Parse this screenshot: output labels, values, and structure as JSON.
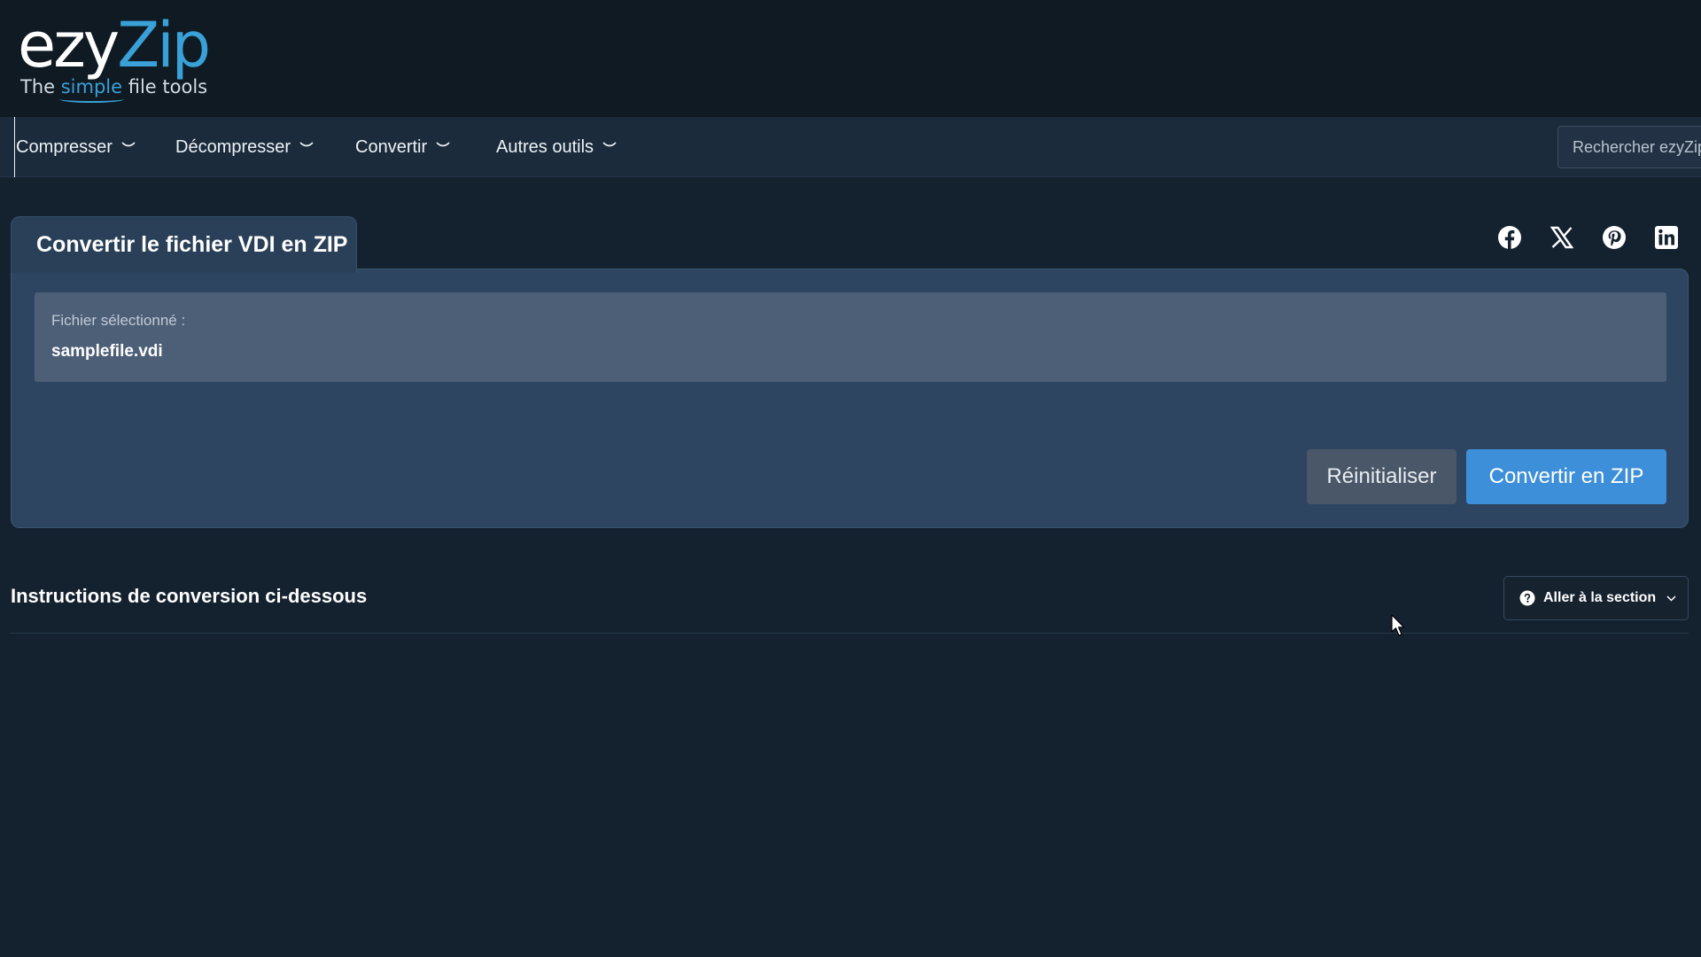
{
  "header": {
    "logo": {
      "brand_part1": "ezy",
      "brand_part2": "Zip",
      "tagline_pre": "The ",
      "tagline_simple": "simple",
      "tagline_post": " file tools"
    }
  },
  "nav": {
    "items": [
      {
        "label": "Compresser"
      },
      {
        "label": "Décompresser"
      },
      {
        "label": "Convertir"
      },
      {
        "label": "Autres outils"
      }
    ],
    "search": {
      "placeholder": "Rechercher ezyZip"
    }
  },
  "tool": {
    "tab_title": "Convertir le fichier VDI en ZIP",
    "social_icons": [
      "facebook-icon",
      "x-icon",
      "pinterest-icon",
      "linkedin-icon"
    ],
    "selected_file_label": "Fichier sélectionné :",
    "selected_file_name": "samplefile.vdi",
    "reset_label": "Réinitialiser",
    "convert_label": "Convertir en ZIP"
  },
  "instructions": {
    "title": "Instructions de conversion ci-dessous",
    "goto_label": "Aller à la section"
  },
  "colors": {
    "page_bg": "#14212f",
    "header_bg": "#0f1a23",
    "nav_bg": "#1b2b3c",
    "card_bg": "#2d4560",
    "file_panel_bg": "#4d5f77",
    "accent": "#3d8fd9",
    "logo_blue": "#3aa0d8"
  }
}
